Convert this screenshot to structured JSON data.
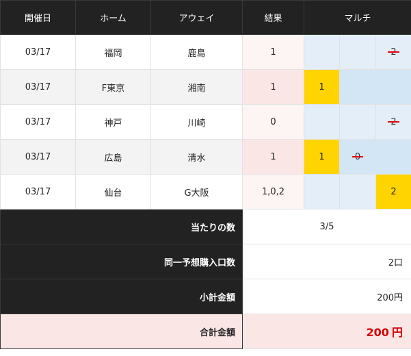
{
  "header": {
    "date": "開催日",
    "home": "ホーム",
    "away": "アウェイ",
    "result": "結果",
    "multi": "マルチ"
  },
  "matches": [
    {
      "date": "03/17",
      "home": "福岡",
      "away": "鹿島",
      "result": "1",
      "picks": [
        "",
        "",
        "2"
      ],
      "picks_state": [
        "none",
        "none",
        "miss"
      ]
    },
    {
      "date": "03/17",
      "home": "F東京",
      "away": "湘南",
      "result": "1",
      "picks": [
        "1",
        "",
        ""
      ],
      "picks_state": [
        "hit",
        "none",
        "none"
      ]
    },
    {
      "date": "03/17",
      "home": "神戸",
      "away": "川崎",
      "result": "0",
      "picks": [
        "",
        "",
        "2"
      ],
      "picks_state": [
        "none",
        "none",
        "miss"
      ]
    },
    {
      "date": "03/17",
      "home": "広島",
      "away": "清水",
      "result": "1",
      "picks": [
        "1",
        "0",
        ""
      ],
      "picks_state": [
        "hit",
        "miss",
        "none"
      ]
    },
    {
      "date": "03/17",
      "home": "仙台",
      "away": "G大阪",
      "result": "1,0,2",
      "picks": [
        "",
        "",
        "2"
      ],
      "picks_state": [
        "none",
        "none",
        "hit"
      ]
    }
  ],
  "summary": {
    "hits_label": "当たりの数",
    "hits_value": "3/5",
    "units_label": "同一予想購入口数",
    "units_value": "2口",
    "subtotal_label": "小計金額",
    "subtotal_value": "200円",
    "total_label": "合計金額",
    "total_value": "200",
    "total_unit": "円"
  },
  "colors": {
    "header_bg": "#222222",
    "hit_bg": "#ffd400",
    "miss_strike": "#e60012",
    "total_text": "#d60000"
  }
}
